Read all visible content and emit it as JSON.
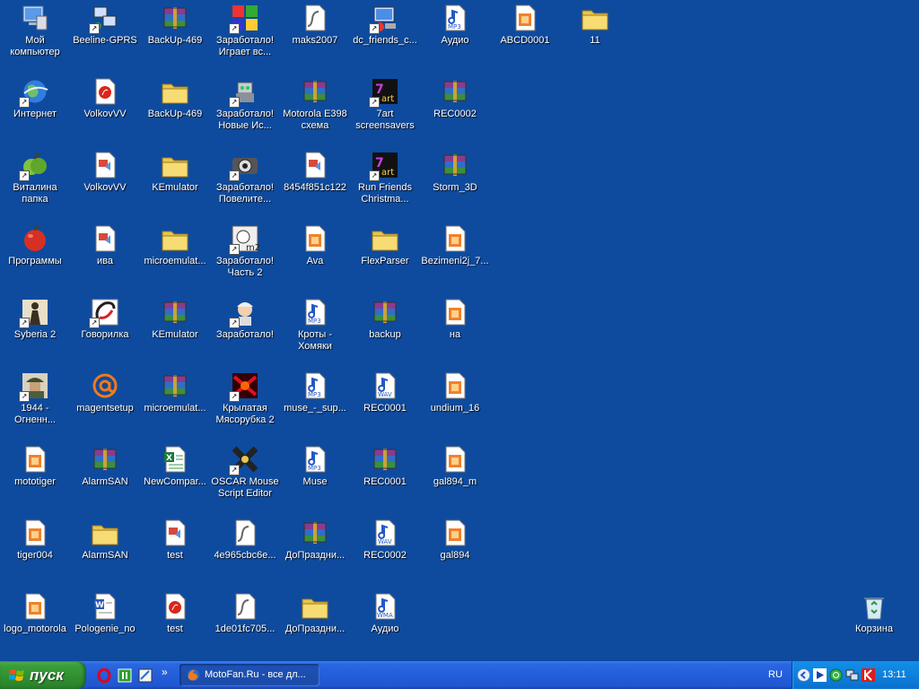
{
  "desktop": {
    "icons": [
      {
        "label": "Мой компьютер",
        "icon": "my-computer",
        "shortcut": false
      },
      {
        "label": "Интернет",
        "icon": "internet",
        "shortcut": true
      },
      {
        "label": "Виталина папка",
        "icon": "green-apple",
        "shortcut": true
      },
      {
        "label": "Программы",
        "icon": "red-apple",
        "shortcut": false
      },
      {
        "label": "Syberia 2",
        "icon": "syberia",
        "shortcut": true
      },
      {
        "label": "1944 - Огненн...",
        "icon": "soldier",
        "shortcut": true
      },
      {
        "label": "mototiger",
        "icon": "image-file",
        "shortcut": false
      },
      {
        "label": "tiger004",
        "icon": "image-file",
        "shortcut": false
      },
      {
        "label": "logo_motorola",
        "icon": "image-file",
        "shortcut": false
      },
      {
        "label": "Beeline-GPRS",
        "icon": "network",
        "shortcut": true
      },
      {
        "label": "VolkovVV",
        "icon": "pdf",
        "shortcut": false
      },
      {
        "label": "VolkovVV",
        "icon": "ppt",
        "shortcut": false
      },
      {
        "label": "ива",
        "icon": "ppt",
        "shortcut": false
      },
      {
        "label": "Говорилка",
        "icon": "phone",
        "shortcut": true
      },
      {
        "label": "magentsetup",
        "icon": "at",
        "shortcut": false
      },
      {
        "label": "AlarmSAN",
        "icon": "winrar",
        "shortcut": false
      },
      {
        "label": "AlarmSAN",
        "icon": "folder",
        "shortcut": false
      },
      {
        "label": "Pologenie_no",
        "icon": "word",
        "shortcut": false
      },
      {
        "label": "BackUp-469",
        "icon": "winrar",
        "shortcut": false
      },
      {
        "label": "BackUp-469",
        "icon": "folder",
        "shortcut": false
      },
      {
        "label": "KEmulator",
        "icon": "folder",
        "shortcut": false
      },
      {
        "label": "microemulat...",
        "icon": "folder",
        "shortcut": false
      },
      {
        "label": "KEmulator",
        "icon": "winrar",
        "shortcut": false
      },
      {
        "label": "microemulat...",
        "icon": "winrar",
        "shortcut": false
      },
      {
        "label": "NewCompar...",
        "icon": "excel",
        "shortcut": false
      },
      {
        "label": "test",
        "icon": "ppt",
        "shortcut": false
      },
      {
        "label": "test",
        "icon": "pdf",
        "shortcut": false
      },
      {
        "label": "Заработало! Играет вс...",
        "icon": "game-colors",
        "shortcut": true
      },
      {
        "label": "Заработало! Новые Ис...",
        "icon": "robot",
        "shortcut": true
      },
      {
        "label": "Заработало! Повелите...",
        "icon": "camera",
        "shortcut": true
      },
      {
        "label": "Заработало! Часть 2",
        "icon": "game-m2",
        "shortcut": true
      },
      {
        "label": "Заработало!",
        "icon": "scientist",
        "shortcut": true
      },
      {
        "label": "Крылатая Мясорубка 2",
        "icon": "game-red",
        "shortcut": true
      },
      {
        "label": "OSCAR Mouse Script Editor",
        "icon": "oscar",
        "shortcut": true
      },
      {
        "label": "4e965cbc6e...",
        "icon": "flash",
        "shortcut": false
      },
      {
        "label": "1de01fc705...",
        "icon": "flash",
        "shortcut": false
      },
      {
        "label": "maks2007",
        "icon": "flash",
        "shortcut": false
      },
      {
        "label": "Motorola E398 схема",
        "icon": "winrar",
        "shortcut": false
      },
      {
        "label": "8454f851c122",
        "icon": "ppt",
        "shortcut": false
      },
      {
        "label": "Ava",
        "icon": "image-file",
        "shortcut": false
      },
      {
        "label": "Кроты - Хомяки",
        "icon": "mp3",
        "shortcut": false
      },
      {
        "label": "muse_-_sup...",
        "icon": "mp3",
        "shortcut": false
      },
      {
        "label": "Muse",
        "icon": "mp3",
        "shortcut": false
      },
      {
        "label": "ДоПраздни...",
        "icon": "winrar",
        "shortcut": false
      },
      {
        "label": "ДоПраздни...",
        "icon": "folder",
        "shortcut": false
      },
      {
        "label": "dc_friends_c...",
        "icon": "computer-app",
        "shortcut": true
      },
      {
        "label": "7art screensavers",
        "icon": "7art",
        "shortcut": true
      },
      {
        "label": "Run Friends Christma...",
        "icon": "7art",
        "shortcut": true
      },
      {
        "label": "FlexParser",
        "icon": "folder",
        "shortcut": false
      },
      {
        "label": "backup",
        "icon": "winrar",
        "shortcut": false
      },
      {
        "label": "REC0001",
        "icon": "wav",
        "shortcut": false
      },
      {
        "label": "REC0001",
        "icon": "winrar",
        "shortcut": false
      },
      {
        "label": "REC0002",
        "icon": "wav",
        "shortcut": false
      },
      {
        "label": "Аудио",
        "icon": "wma",
        "shortcut": false
      },
      {
        "label": "Аудио",
        "icon": "mp3",
        "shortcut": false
      },
      {
        "label": "REC0002",
        "icon": "winrar",
        "shortcut": false
      },
      {
        "label": "Storm_3D",
        "icon": "winrar",
        "shortcut": false
      },
      {
        "label": "Bezimeni2j_7...",
        "icon": "image-file",
        "shortcut": false
      },
      {
        "label": "на",
        "icon": "image-file",
        "shortcut": false
      },
      {
        "label": "undium_16",
        "icon": "image-file",
        "shortcut": false
      },
      {
        "label": "gal894_m",
        "icon": "image-file",
        "shortcut": false
      },
      {
        "label": "gal894",
        "icon": "image-file",
        "shortcut": false
      },
      {
        "label": "ABCD0001",
        "icon": "image-file",
        "shortcut": false
      },
      {
        "label": "11",
        "icon": "folder",
        "shortcut": false
      },
      {
        "label": "Корзина",
        "icon": "recycle-bin",
        "shortcut": false
      }
    ]
  },
  "taskbar": {
    "start_label": "пуск",
    "quick_launch": [
      "opera-icon",
      "icq-icon",
      "notepad-icon",
      "chevron-icon"
    ],
    "task_button": {
      "title": "MotoFan.Ru - все дл...",
      "icon": "firefox-icon"
    },
    "language": "RU",
    "tray_icons": [
      "back-arrow-icon",
      "media-player-icon",
      "globe-icon",
      "network-icon",
      "kaspersky-icon"
    ],
    "clock": "13:11"
  },
  "colors": {
    "desktop": "#0e4b9e",
    "taskbar": "#245edb",
    "start": "#3c9d3c",
    "tray": "#0f80dd"
  }
}
